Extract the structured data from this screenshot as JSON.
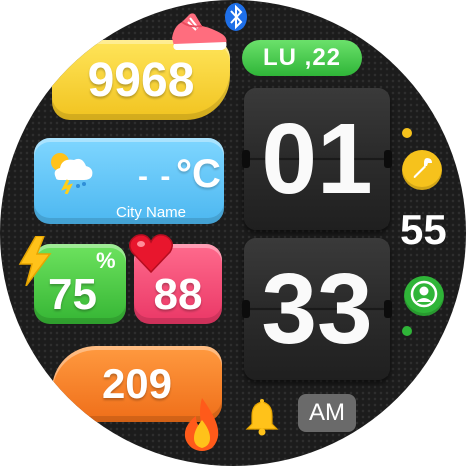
{
  "steps": {
    "value": "9968",
    "icon": "sneaker-icon"
  },
  "status": {
    "bluetooth_icon": "bluetooth-icon"
  },
  "date": {
    "text": "LU ,22"
  },
  "weather": {
    "temperature": "- -",
    "unit": "°C",
    "city": "City Name",
    "icon": "thunderstorm-cloud-icon"
  },
  "battery": {
    "value": "75",
    "unit": "%",
    "icon": "lightning-icon"
  },
  "heart_rate": {
    "value": "88",
    "icon": "heart-icon"
  },
  "calories": {
    "value": "209",
    "icon": "fire-icon"
  },
  "time": {
    "hours": "01",
    "minutes": "33",
    "seconds": "55",
    "ampm": "AM"
  },
  "shortcuts": {
    "settings_icon": "wrench-icon",
    "profile_icon": "user-icon",
    "alarm_icon": "bell-icon"
  },
  "colors": {
    "steps": "#f1c31f",
    "weather": "#4cb7f0",
    "battery": "#35b534",
    "heart": "#ea3766",
    "calories": "#ef6e19",
    "date": "#2fb538",
    "settings": "#f6c21c",
    "profile": "#2fb538"
  }
}
